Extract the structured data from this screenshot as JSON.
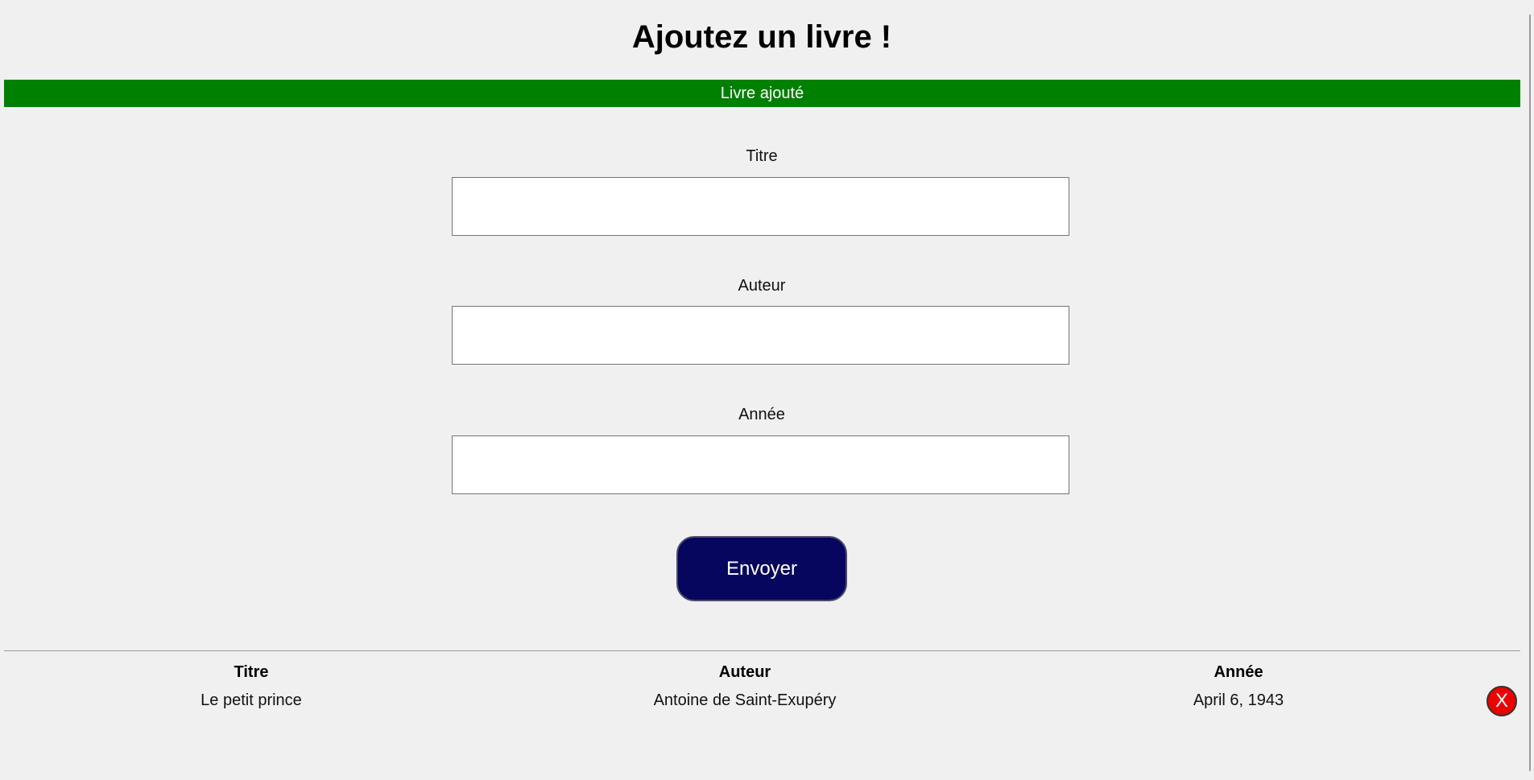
{
  "header": {
    "title": "Ajoutez un livre !"
  },
  "status": {
    "message": "Livre ajouté",
    "color": "#008000"
  },
  "form": {
    "fields": [
      {
        "label": "Titre",
        "value": "",
        "placeholder": ""
      },
      {
        "label": "Auteur",
        "value": "",
        "placeholder": ""
      },
      {
        "label": "Année",
        "value": "",
        "placeholder": ""
      }
    ],
    "submit_label": "Envoyer",
    "submit_color": "#06065e"
  },
  "table": {
    "headers": [
      "Titre",
      "Auteur",
      "Année"
    ],
    "rows": [
      {
        "cells": [
          "Le petit prince",
          "Antoine de Saint-Exupéry",
          "April 6, 1943"
        ],
        "delete_label": "X"
      }
    ],
    "delete_color": "#ee0000"
  }
}
